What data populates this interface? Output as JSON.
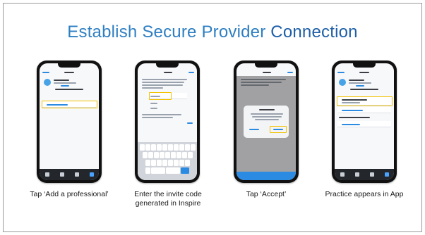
{
  "title": {
    "part1": "Establish Secure Provider ",
    "part2": "Connection"
  },
  "steps": [
    {
      "caption": "Tap ‘Add a professional’"
    },
    {
      "caption": "Enter the invite code generated in Inspire"
    },
    {
      "caption": "Tap ‘Accept’"
    },
    {
      "caption": "Practice appears in App"
    }
  ],
  "colors": {
    "title_light": "#2e7fc3",
    "title_dark": "#1f5fa8",
    "highlight": "#f2c200",
    "app_blue": "#2b8be3"
  }
}
